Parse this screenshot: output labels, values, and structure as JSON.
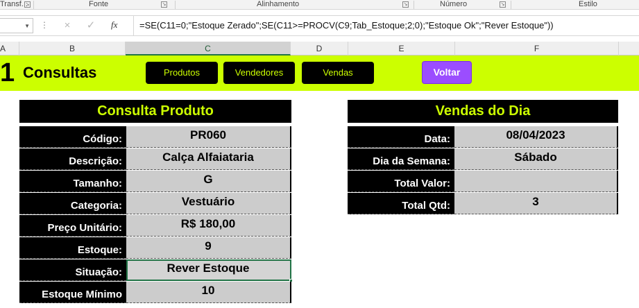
{
  "ribbon": {
    "groups": [
      "Transf...",
      "Fonte",
      "Alinhamento",
      "Número",
      "Estilo"
    ]
  },
  "formula_bar": {
    "name_box": "",
    "cancel_icon": "×",
    "enter_icon": "✓",
    "fx_label": "fx",
    "formula": "=SE(C11=0;\"Estoque Zerado\";SE(C11>=PROCV(C9;Tab_Estoque;2;0);\"Estoque Ok\";\"Rever Estoque\"))"
  },
  "columns": [
    "A",
    "B",
    "C",
    "D",
    "E",
    "F"
  ],
  "active_column": "C",
  "header": {
    "logo_digit": "1",
    "title": "Consultas",
    "nav": [
      "Produtos",
      "Vendedores",
      "Vendas"
    ],
    "voltar_label": "Voltar"
  },
  "produto": {
    "title": "Consulta Produto",
    "rows": [
      {
        "label": "Código:",
        "value": "PR060"
      },
      {
        "label": "Descrição:",
        "value": "Calça Alfaiataria"
      },
      {
        "label": "Tamanho:",
        "value": "G"
      },
      {
        "label": "Categoria:",
        "value": "Vestuário"
      },
      {
        "label": "Preço Unitário:",
        "value": "R$ 180,00"
      },
      {
        "label": "Estoque:",
        "value": "9"
      },
      {
        "label": "Situação:",
        "value": "Rever Estoque"
      },
      {
        "label": "Estoque Mínimo",
        "value": "10"
      }
    ]
  },
  "vendas": {
    "title": "Vendas do Dia",
    "rows": [
      {
        "label": "Data:",
        "value": "08/04/2023"
      },
      {
        "label": "Dia da Semana:",
        "value": "Sábado"
      },
      {
        "label": "Total Valor:",
        "value": ""
      },
      {
        "label": "Total Qtd:",
        "value": "3"
      }
    ]
  },
  "colors": {
    "band": "#ccff00",
    "panel_title_text": "#ccff00",
    "voltar_button": "#9b4dff",
    "selection": "#217346"
  }
}
